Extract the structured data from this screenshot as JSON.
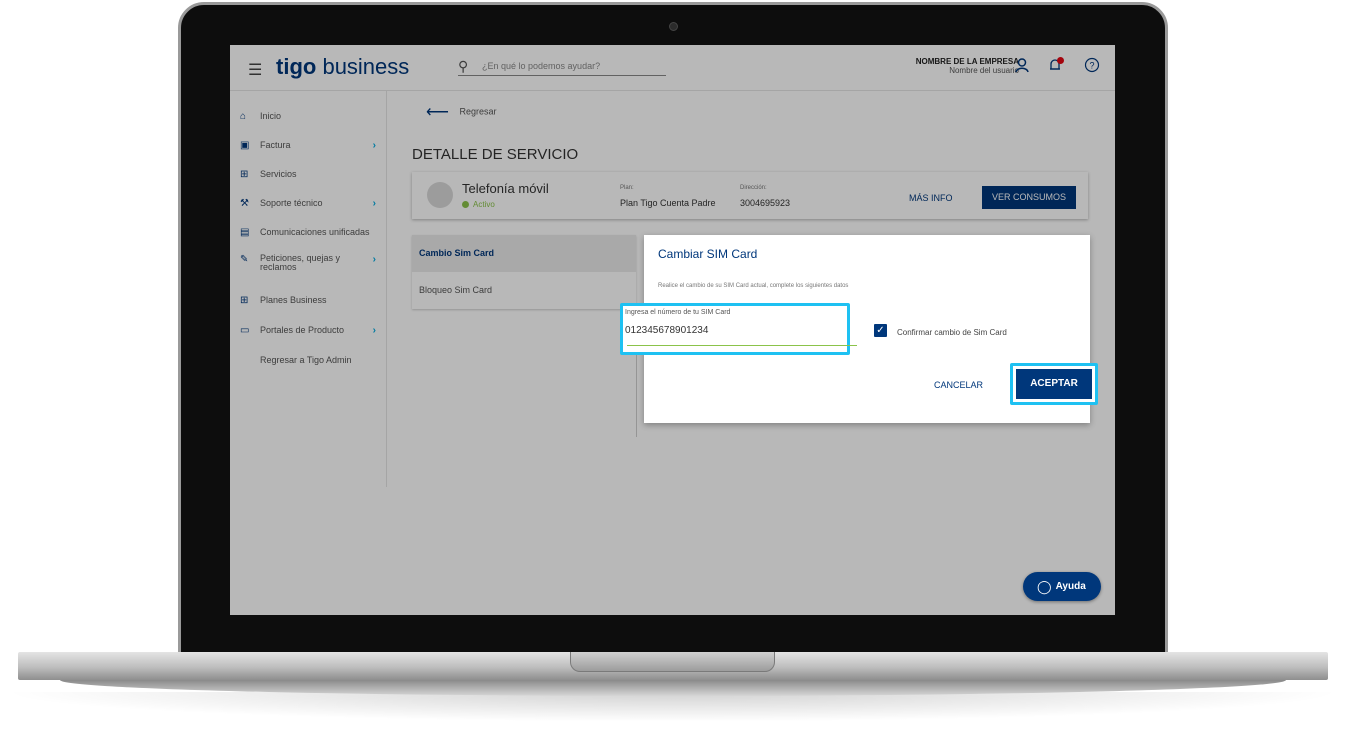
{
  "topbar": {
    "logo_brand": "tigo",
    "logo_suffix": "business",
    "search_placeholder": "¿En qué lo podemos ayudar?",
    "company_name": "NOMBRE DE LA EMPRESA",
    "user_name": "Nombre del usuario"
  },
  "sidebar": {
    "items": [
      {
        "label": "Inicio",
        "icon": "home-icon",
        "has_arrow": false
      },
      {
        "label": "Factura",
        "icon": "invoice-icon",
        "has_arrow": true
      },
      {
        "label": "Servicios",
        "icon": "grid-icon",
        "has_arrow": false
      },
      {
        "label": "Soporte técnico",
        "icon": "tools-icon",
        "has_arrow": true
      },
      {
        "label": "Comunicaciones unificadas",
        "icon": "calendar-icon",
        "has_arrow": false
      },
      {
        "label": "Peticiones, quejas y reclamos",
        "icon": "edit-icon",
        "has_arrow": true
      },
      {
        "label": "Planes Business",
        "icon": "grid-icon",
        "has_arrow": false
      },
      {
        "label": "Portales de Producto",
        "icon": "monitor-icon",
        "has_arrow": true
      },
      {
        "label": "Regresar a Tigo Admin",
        "icon": "",
        "has_arrow": false
      }
    ]
  },
  "main": {
    "back_label": "Regresar",
    "page_title": "DETALLE DE SERVICIO",
    "service": {
      "name": "Telefonía móvil",
      "status": "Activo",
      "plan_label": "Plan:",
      "plan_value": "Plan Tigo Cuenta Padre",
      "address_label": "Dirección:",
      "address_value": "3004695923",
      "more_info": "MÁS INFO",
      "view_consumption": "VER CONSUMOS"
    },
    "tabs": [
      {
        "label": "Cambio Sim Card",
        "active": true
      },
      {
        "label": "Bloqueo Sim Card",
        "active": false
      }
    ]
  },
  "modal": {
    "title": "Cambiar SIM Card",
    "description": "Realice el cambio de su SIM Card actual, complete los siguientes datos",
    "field_label": "Ingresa el número de tu SIM Card",
    "field_value": "012345678901234",
    "confirm_label": "Confirmar cambio de Sim Card",
    "confirm_checked": true,
    "cancel_label": "CANCELAR",
    "accept_label": "ACEPTAR"
  },
  "help": {
    "label": "Ayuda"
  },
  "colors": {
    "brand_navy": "#00377b",
    "accent_cyan": "#1ec1f2",
    "active_green": "#8bc34a",
    "notification_red": "#e30613"
  }
}
